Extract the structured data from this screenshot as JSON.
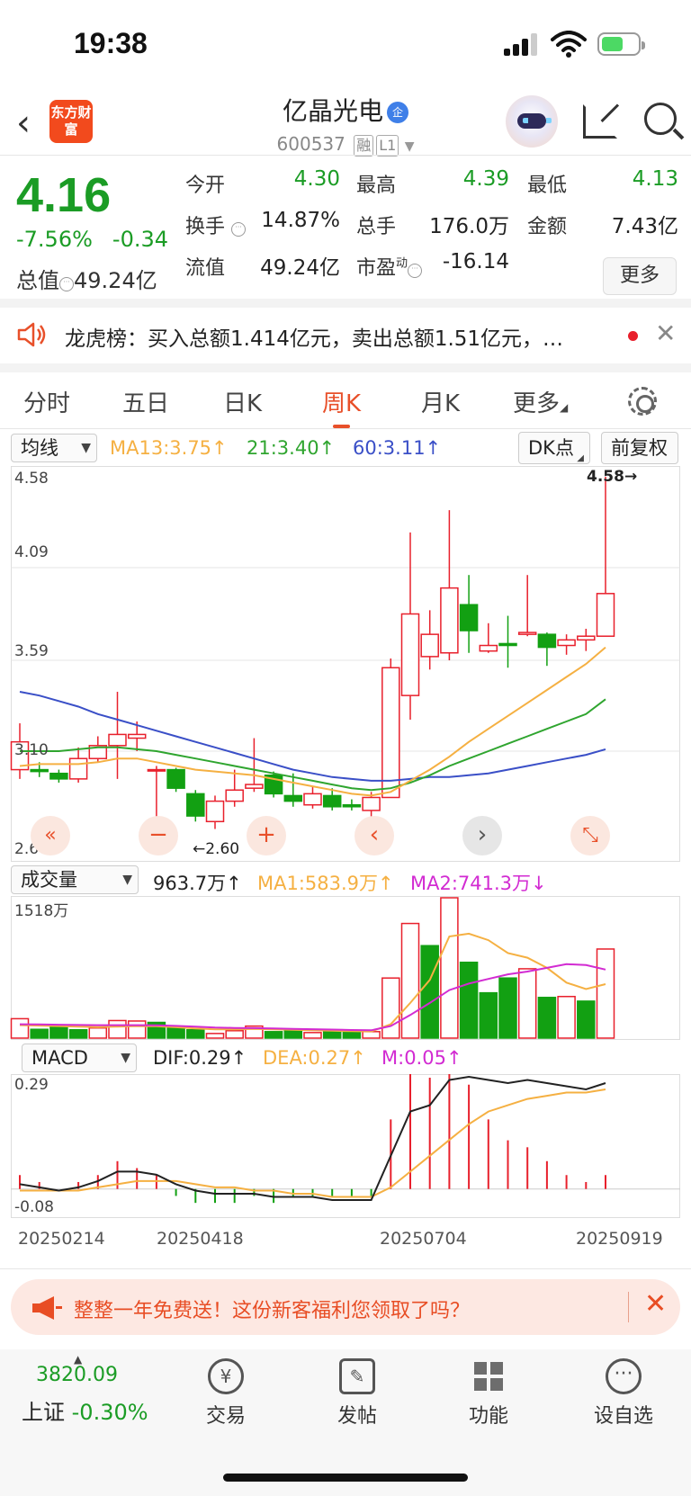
{
  "status_bar": {
    "time": "19:38"
  },
  "header": {
    "logo_text": "东方财富",
    "stock_name": "亿晶光电",
    "name_badge": "企",
    "code": "600537",
    "tags": [
      "融",
      "L1"
    ]
  },
  "quote": {
    "price": "4.16",
    "change_pct": "-7.56%",
    "change": "-0.34",
    "total_value_label": "总值",
    "total_value": "49.24亿",
    "fields": [
      {
        "label": "今开",
        "value": "4.30",
        "color": "green"
      },
      {
        "label": "最高",
        "value": "4.39",
        "color": "green"
      },
      {
        "label": "最低",
        "value": "4.13",
        "color": "green"
      },
      {
        "label": "换手",
        "value": "14.87%",
        "color": "black"
      },
      {
        "label": "总手",
        "value": "176.0万",
        "color": "black"
      },
      {
        "label": "金额",
        "value": "7.43亿",
        "color": "black"
      },
      {
        "label": "流值",
        "value": "49.24亿",
        "color": "black"
      },
      {
        "label": "市盈",
        "value": "-16.14",
        "color": "black"
      }
    ],
    "pe_sup": "动",
    "more_label": "更多"
  },
  "notice": {
    "text": "龙虎榜：买入总额1.414亿元，卖出总额1.51亿元，…"
  },
  "tabs": [
    {
      "label": "分时",
      "active": false
    },
    {
      "label": "五日",
      "active": false
    },
    {
      "label": "日K",
      "active": false
    },
    {
      "label": "周K",
      "active": true
    },
    {
      "label": "月K",
      "active": false
    },
    {
      "label": "更多",
      "active": false
    }
  ],
  "kline": {
    "indicator_select": "均线",
    "ma13": "MA13:3.75↑",
    "ma21": "21:3.40↑",
    "ma60": "60:3.11↑",
    "dk_label": "DK点",
    "adjust_label": "前复权",
    "y_ticks": [
      "4.58",
      "4.09",
      "3.59",
      "3.10",
      "2.60"
    ],
    "high_marker": "4.58→",
    "low_marker": "←2.60",
    "colors": {
      "up": "#e8202c",
      "down": "#12a012",
      "ma13": "#f5b042",
      "ma21": "#2fa52f",
      "ma60": "#3a4fc7"
    }
  },
  "volume": {
    "select": "成交量",
    "current": "963.7万↑",
    "ma1": "MA1:583.9万↑",
    "ma2": "MA2:741.3万↓",
    "max_label": "1518万"
  },
  "macd": {
    "select": "MACD",
    "dif": "DIF:0.29↑",
    "dea": "DEA:0.27↑",
    "m": "M:0.05↑",
    "y_top": "0.29",
    "y_bottom": "-0.08"
  },
  "x_dates": [
    "20250214",
    "20250418",
    "20250704",
    "20250919"
  ],
  "chart_data": {
    "type": "candlestick",
    "period": "weekly",
    "candles": [
      {
        "o": 3.0,
        "c": 3.15,
        "h": 3.25,
        "l": 2.95
      },
      {
        "o": 3.0,
        "c": 2.99,
        "h": 3.04,
        "l": 2.96
      },
      {
        "o": 2.98,
        "c": 2.95,
        "h": 3.0,
        "l": 2.93
      },
      {
        "o": 2.95,
        "c": 3.06,
        "h": 3.12,
        "l": 2.93
      },
      {
        "o": 3.06,
        "c": 3.13,
        "h": 3.18,
        "l": 3.04
      },
      {
        "o": 3.13,
        "c": 3.19,
        "h": 3.42,
        "l": 2.95
      },
      {
        "o": 3.17,
        "c": 3.19,
        "h": 3.26,
        "l": 3.1
      },
      {
        "o": 3.0,
        "c": 3.0,
        "h": 3.02,
        "l": 2.6
      },
      {
        "o": 3.0,
        "c": 2.9,
        "h": 3.01,
        "l": 2.88
      },
      {
        "o": 2.87,
        "c": 2.75,
        "h": 2.89,
        "l": 2.72
      },
      {
        "o": 2.72,
        "c": 2.83,
        "h": 2.86,
        "l": 2.68
      },
      {
        "o": 2.83,
        "c": 2.89,
        "h": 3.0,
        "l": 2.8
      },
      {
        "o": 2.9,
        "c": 2.92,
        "h": 3.17,
        "l": 2.88
      },
      {
        "o": 2.97,
        "c": 2.87,
        "h": 2.99,
        "l": 2.85
      },
      {
        "o": 2.86,
        "c": 2.83,
        "h": 2.98,
        "l": 2.8
      },
      {
        "o": 2.81,
        "c": 2.87,
        "h": 2.91,
        "l": 2.79
      },
      {
        "o": 2.86,
        "c": 2.8,
        "h": 2.9,
        "l": 2.78
      },
      {
        "o": 2.81,
        "c": 2.8,
        "h": 2.84,
        "l": 2.78
      },
      {
        "o": 2.78,
        "c": 2.85,
        "h": 2.88,
        "l": 2.74
      },
      {
        "o": 2.85,
        "c": 3.55,
        "h": 3.6,
        "l": 2.85
      },
      {
        "o": 3.4,
        "c": 3.84,
        "h": 4.28,
        "l": 3.27
      },
      {
        "o": 3.61,
        "c": 3.73,
        "h": 3.86,
        "l": 3.54
      },
      {
        "o": 3.63,
        "c": 3.98,
        "h": 4.4,
        "l": 3.59
      },
      {
        "o": 3.89,
        "c": 3.75,
        "h": 4.05,
        "l": 3.63
      },
      {
        "o": 3.64,
        "c": 3.67,
        "h": 3.79,
        "l": 3.63
      },
      {
        "o": 3.68,
        "c": 3.67,
        "h": 3.83,
        "l": 3.55
      },
      {
        "o": 3.73,
        "c": 3.74,
        "h": 4.05,
        "l": 3.72
      },
      {
        "o": 3.73,
        "c": 3.66,
        "h": 3.74,
        "l": 3.56
      },
      {
        "o": 3.67,
        "c": 3.7,
        "h": 3.73,
        "l": 3.62
      },
      {
        "o": 3.7,
        "c": 3.72,
        "h": 3.76,
        "l": 3.64
      },
      {
        "o": 3.72,
        "c": 3.95,
        "h": 4.58,
        "l": 3.72
      }
    ],
    "ma13": [
      3.02,
      3.03,
      3.03,
      3.03,
      3.04,
      3.06,
      3.06,
      3.04,
      3.02,
      3.0,
      2.99,
      2.98,
      2.97,
      2.95,
      2.93,
      2.91,
      2.89,
      2.87,
      2.86,
      2.88,
      2.94,
      3.0,
      3.07,
      3.15,
      3.22,
      3.29,
      3.36,
      3.43,
      3.5,
      3.57,
      3.66
    ],
    "ma21": [
      3.1,
      3.1,
      3.1,
      3.11,
      3.12,
      3.12,
      3.11,
      3.1,
      3.08,
      3.06,
      3.04,
      3.02,
      3.0,
      2.98,
      2.96,
      2.94,
      2.92,
      2.9,
      2.89,
      2.9,
      2.93,
      2.97,
      3.02,
      3.06,
      3.1,
      3.14,
      3.18,
      3.22,
      3.26,
      3.3,
      3.38
    ],
    "ma60": [
      3.42,
      3.4,
      3.37,
      3.34,
      3.3,
      3.27,
      3.24,
      3.21,
      3.18,
      3.15,
      3.12,
      3.09,
      3.06,
      3.03,
      3.0,
      2.98,
      2.96,
      2.95,
      2.94,
      2.94,
      2.95,
      2.96,
      2.96,
      2.97,
      2.98,
      3.0,
      3.02,
      3.04,
      3.06,
      3.08,
      3.11
    ],
    "volume": [
      210,
      95,
      140,
      90,
      110,
      190,
      185,
      170,
      110,
      90,
      50,
      80,
      130,
      70,
      80,
      60,
      70,
      70,
      70,
      650,
      1240,
      1000,
      1518,
      820,
      490,
      650,
      750,
      440,
      450,
      400,
      963.7
    ],
    "vol_up": [
      true,
      false,
      false,
      false,
      true,
      true,
      true,
      false,
      false,
      false,
      true,
      true,
      true,
      false,
      false,
      true,
      false,
      false,
      true,
      true,
      true,
      false,
      true,
      false,
      false,
      false,
      true,
      false,
      true,
      false,
      true
    ],
    "vol_ma1": [
      140,
      135,
      130,
      125,
      120,
      125,
      130,
      128,
      118,
      105,
      95,
      95,
      100,
      95,
      90,
      85,
      80,
      75,
      72,
      150,
      380,
      630,
      1100,
      1130,
      1060,
      920,
      870,
      760,
      600,
      530,
      583.9
    ],
    "vol_ma2": [
      150,
      148,
      145,
      142,
      140,
      140,
      140,
      138,
      132,
      125,
      115,
      110,
      108,
      105,
      100,
      96,
      92,
      88,
      85,
      130,
      250,
      380,
      520,
      590,
      640,
      690,
      720,
      760,
      800,
      790,
      741.3
    ],
    "dif": [
      -0.03,
      -0.04,
      -0.05,
      -0.04,
      -0.02,
      0.01,
      0.01,
      0.0,
      -0.03,
      -0.05,
      -0.06,
      -0.06,
      -0.06,
      -0.07,
      -0.07,
      -0.07,
      -0.08,
      -0.08,
      -0.08,
      0.06,
      0.2,
      0.22,
      0.3,
      0.31,
      0.3,
      0.29,
      0.3,
      0.29,
      0.28,
      0.27,
      0.29
    ],
    "dea": [
      -0.05,
      -0.05,
      -0.05,
      -0.05,
      -0.04,
      -0.03,
      -0.02,
      -0.02,
      -0.02,
      -0.03,
      -0.04,
      -0.04,
      -0.05,
      -0.05,
      -0.06,
      -0.06,
      -0.07,
      -0.07,
      -0.07,
      -0.04,
      0.01,
      0.06,
      0.11,
      0.16,
      0.2,
      0.22,
      0.24,
      0.25,
      0.26,
      0.26,
      0.27
    ],
    "ylim_price": [
      2.6,
      4.58
    ],
    "ylim_vol": [
      0,
      1518
    ],
    "ylim_macd": [
      -0.08,
      0.29
    ]
  },
  "ad_banner": {
    "text": "整整一年免费送！这份新客福利您领取了吗？"
  },
  "bottom_bar": {
    "index_value": "3820.09",
    "index_name": "上证",
    "index_change": "-0.30%",
    "items": [
      "交易",
      "发帖",
      "功能",
      "设自选"
    ]
  }
}
